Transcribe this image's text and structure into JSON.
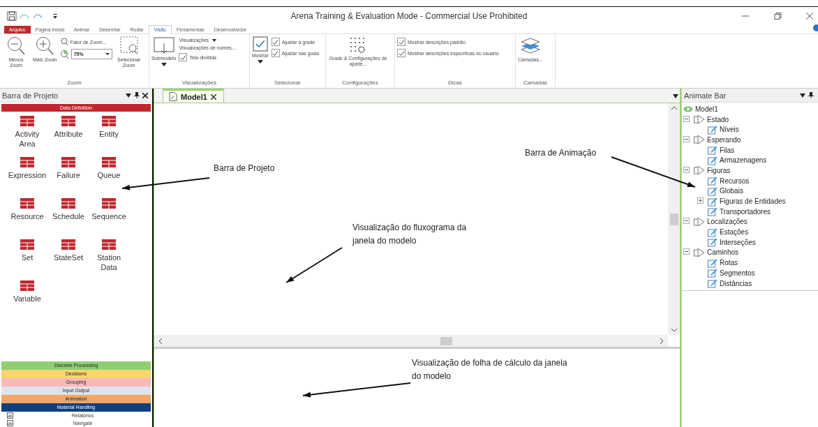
{
  "window": {
    "title": "Arena Training & Evaluation Mode - Commercial Use Prohibited"
  },
  "ribbon_tabs": [
    {
      "label": "Arquivo",
      "kind": "file",
      "selected": false
    },
    {
      "label": "Pagina inicial",
      "kind": "tab",
      "selected": false
    },
    {
      "label": "Animar",
      "kind": "tab",
      "selected": false
    },
    {
      "label": "Desenhar",
      "kind": "tab",
      "selected": false
    },
    {
      "label": "Rodar",
      "kind": "tab",
      "selected": false
    },
    {
      "label": "Visão",
      "kind": "tab",
      "selected": true
    },
    {
      "label": "Ferramentas",
      "kind": "tab",
      "selected": false
    },
    {
      "label": "Desenvolvedor",
      "kind": "tab",
      "selected": false
    }
  ],
  "ribbon": {
    "zoom": {
      "label": "Zoom",
      "zoom_out": "Menos Zoom",
      "zoom_in": "Mais Zoom",
      "zoom_factor": "Fator de Zoom...",
      "zoom_value": "75%",
      "select_zoom": "Selecionar Zoom"
    },
    "views": {
      "label": "Visualizações",
      "submodel": "Submodelo",
      "views_menu": "Visualizações",
      "named_views": "Visualizações de nomes...",
      "split": {
        "label": "Tela dividida",
        "checked": true
      }
    },
    "select": {
      "label": "Selecionar",
      "show": "Mostrar",
      "checks": [
        {
          "label": "Ajustar à grade",
          "checked": true
        },
        {
          "label": "Ajustar nas guias",
          "checked": true
        }
      ]
    },
    "settings": {
      "label": "Configurações",
      "button": "Grade & Configurações de ajuste..."
    },
    "tips": {
      "label": "Dicas",
      "checks": [
        {
          "label": "Mostrar descrições padrão",
          "checked": true
        },
        {
          "label": "Mostrar descrições específicas do usuário",
          "checked": true
        }
      ]
    },
    "layers": {
      "label": "Camadas",
      "button": "Camadas..."
    }
  },
  "project_bar": {
    "title": "Barra de Projeto",
    "section": "Data Definition",
    "items": [
      "Activity Area",
      "Attribute",
      "Entity",
      "Expression",
      "Failure",
      "Queue",
      "Resource",
      "Schedule",
      "Sequence",
      "Set",
      "StateSet",
      "Station Data",
      "Variable"
    ],
    "panels": [
      {
        "label": "Discrete Processing",
        "color": "#8fcf72"
      },
      {
        "label": "Decisions",
        "color": "#f9d46f"
      },
      {
        "label": "Grouping",
        "color": "#f8b9b9"
      },
      {
        "label": "Input Output",
        "color": "#dfe4ea"
      },
      {
        "label": "Animation",
        "color": "#f4a662"
      },
      {
        "label": "Material Handling",
        "color": "#0b3f82"
      }
    ],
    "footer": [
      "Relatórios",
      "Navigate"
    ]
  },
  "document_tabs": [
    {
      "label": "Model1",
      "selected": true
    }
  ],
  "animate_bar": {
    "title": "Animate Bar",
    "tree": {
      "label": "Model1",
      "children": [
        {
          "label": "Estado",
          "expanded": true,
          "children": [
            {
              "label": "Níveis"
            }
          ]
        },
        {
          "label": "Esperando",
          "expanded": true,
          "children": [
            {
              "label": "Filas"
            },
            {
              "label": "Armazenagens"
            }
          ]
        },
        {
          "label": "Figuras",
          "expanded": true,
          "children": [
            {
              "label": "Recursos"
            },
            {
              "label": "Globais"
            },
            {
              "label": "Figuras de Entidades",
              "expanded": false
            },
            {
              "label": "Transportadores"
            }
          ]
        },
        {
          "label": "Localizações",
          "expanded": true,
          "children": [
            {
              "label": "Estações"
            },
            {
              "label": "Interseções"
            }
          ]
        },
        {
          "label": "Caminhos",
          "expanded": true,
          "children": [
            {
              "label": "Rotas"
            },
            {
              "label": "Segmentos"
            },
            {
              "label": "Distâncias"
            }
          ]
        }
      ]
    }
  },
  "annotations": [
    {
      "text": "Barra de Projeto"
    },
    {
      "text": "Barra de Animação"
    },
    {
      "text": "Visualização do fluxograma da janela do modelo"
    },
    {
      "text": "Visualização de folha de cálculo da janela do modelo"
    }
  ]
}
